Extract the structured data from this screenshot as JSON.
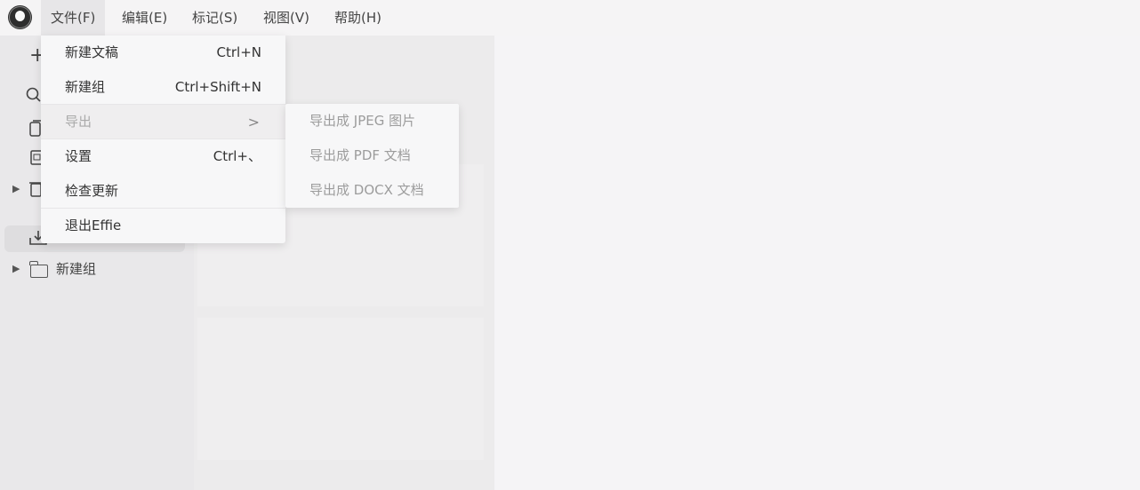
{
  "menubar": {
    "items": [
      "文件(F)",
      "编辑(E)",
      "标记(S)",
      "视图(V)",
      "帮助(H)"
    ],
    "active": 0
  },
  "file_menu": {
    "items": [
      {
        "label": "新建文稿",
        "shortcut": "Ctrl+N",
        "disabled": false
      },
      {
        "label": "新建组",
        "shortcut": "Ctrl+Shift+N",
        "disabled": false
      },
      {
        "label": "导出",
        "shortcut": "",
        "disabled": true,
        "submenu": true
      },
      {
        "label": "设置",
        "shortcut": "Ctrl+、",
        "disabled": false
      },
      {
        "label": "检查更新",
        "shortcut": "",
        "disabled": false
      },
      {
        "label": "退出Effie",
        "shortcut": "",
        "disabled": false
      }
    ]
  },
  "export_submenu": {
    "items": [
      "导出成 JPEG 图片",
      "导出成 PDF 文档",
      "导出成 DOCX 文档"
    ]
  },
  "sidebar": {
    "visible_group_label": "新建组",
    "selected_icon": "inbox-icon"
  },
  "colors": {
    "menubar_bg": "#f5f4f5",
    "menu_active_bg": "#e7e6e8",
    "dropdown_bg": "#f7f7f8",
    "disabled_text": "#aaaaaa"
  }
}
